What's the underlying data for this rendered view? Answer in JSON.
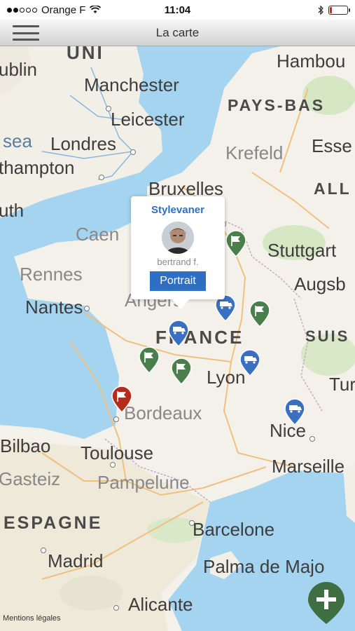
{
  "status": {
    "carrier": "Orange F",
    "time": "11:04",
    "signal_bars_filled": 2,
    "signal_bars_total": 5,
    "battery_level": 0.12,
    "colors": {
      "battery_low": "#e02020"
    }
  },
  "nav": {
    "title": "La carte",
    "menu_icon": "hamburger-icon"
  },
  "map": {
    "countries": [
      "UNI",
      "PAYS-BAS",
      "ALL",
      "FRANCE",
      "SUIS",
      "ESPAGNE"
    ],
    "cities": [
      "ublin",
      "Manchester",
      "Hambou",
      "Leicester",
      "sea",
      "Londres",
      "Krefeld",
      "Esse",
      "thampton",
      "Bruxelles",
      "uth",
      "Caen",
      "Stuttgart",
      "Rennes",
      "Augsb",
      "Nantes",
      "Angers",
      "Lyon",
      "Tur",
      "Bordeaux",
      "Nice",
      "Bilbao",
      "Toulouse",
      "Marseille",
      "Gasteiz",
      "Pampelune",
      "Barcelone",
      "Madrid",
      "Palma de Majo",
      "Alicante"
    ],
    "legal_link": "Mentions légales"
  },
  "markers": {
    "colors": {
      "blue": "#3a70c2",
      "green": "#4a7f4c",
      "red": "#b52c1c"
    },
    "icons": [
      "van-icon",
      "flag-icon"
    ]
  },
  "popup": {
    "title": "Stylevaner",
    "name": "bertrand f.",
    "button": "Portrait"
  },
  "fab": {
    "icon": "plus-icon",
    "color": "#3f6e42"
  }
}
